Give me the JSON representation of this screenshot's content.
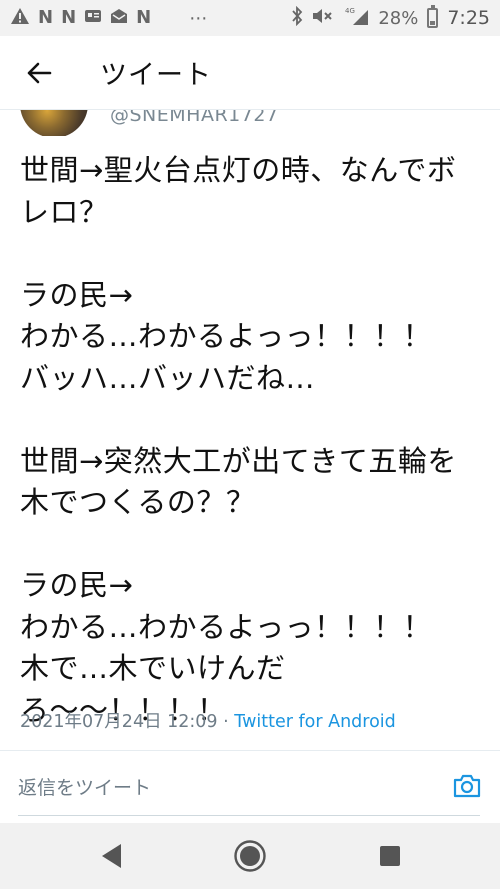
{
  "status_bar": {
    "left_icons": [
      "A",
      "N",
      "N"
    ],
    "dots": "⋯",
    "battery": "28%",
    "network": "4G",
    "time": "7:25"
  },
  "header": {
    "title": "ツイート"
  },
  "author": {
    "handle": "@SNEMHAR1727"
  },
  "tweet": {
    "lines": [
      "世間→聖火台点灯の時、なんでボ",
      "レロ？",
      "",
      "ラの民→",
      "わかる…わかるよっっ！！！！",
      "バッハ…バッハだね…",
      "",
      "世間→突然大工が出てきて五輪を",
      "木でつくるの？？",
      "",
      "ラの民→",
      "わかる…わかるよっっ！！！！",
      "木で…木でいけんだ",
      "ろ〜〜！！！！"
    ],
    "timestamp": "2021年07月24日 12:09",
    "separator": " · ",
    "client": "Twitter for Android"
  },
  "reply": {
    "placeholder": "返信をツイート"
  },
  "colors": {
    "accent": "#1b95e0",
    "muted": "#6e7c87"
  }
}
